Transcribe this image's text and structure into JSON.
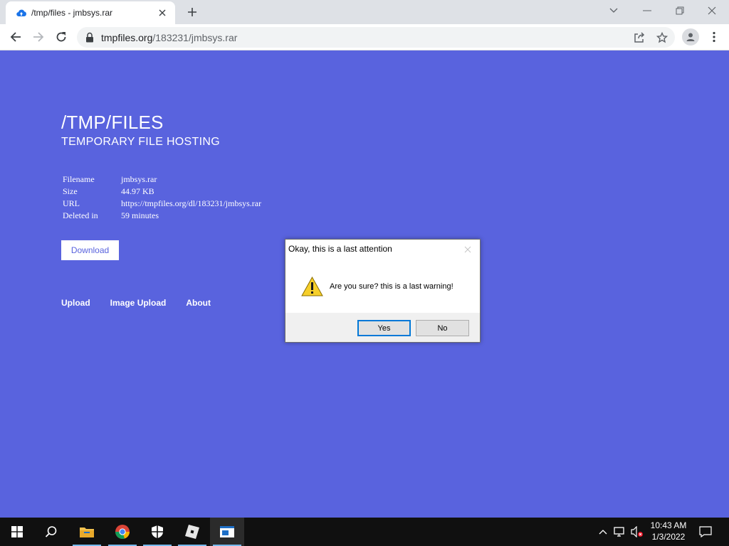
{
  "browser": {
    "tab_title": "/tmp/files - jmbsys.rar",
    "url_domain": "tmpfiles.org",
    "url_path": "/183231/jmbsys.rar"
  },
  "page": {
    "site_title": "/TMP/FILES",
    "site_subtitle": "TEMPORARY FILE HOSTING",
    "info": [
      {
        "label": "Filename",
        "value": "jmbsys.rar"
      },
      {
        "label": "Size",
        "value": "44.97 KB"
      },
      {
        "label": "URL",
        "value": "https://tmpfiles.org/dl/183231/jmbsys.rar"
      },
      {
        "label": "Deleted in",
        "value": "59 minutes"
      }
    ],
    "download_label": "Download",
    "nav": [
      "Upload",
      "Image Upload",
      "About"
    ],
    "background_color": "#5963de"
  },
  "dialog": {
    "title": "Okay, this is a last attention",
    "message": "Are you sure? this is a last warning!",
    "yes_label": "Yes",
    "no_label": "No",
    "icon": "warning-icon"
  },
  "taskbar": {
    "time": "10:43 AM",
    "date": "1/3/2022"
  }
}
